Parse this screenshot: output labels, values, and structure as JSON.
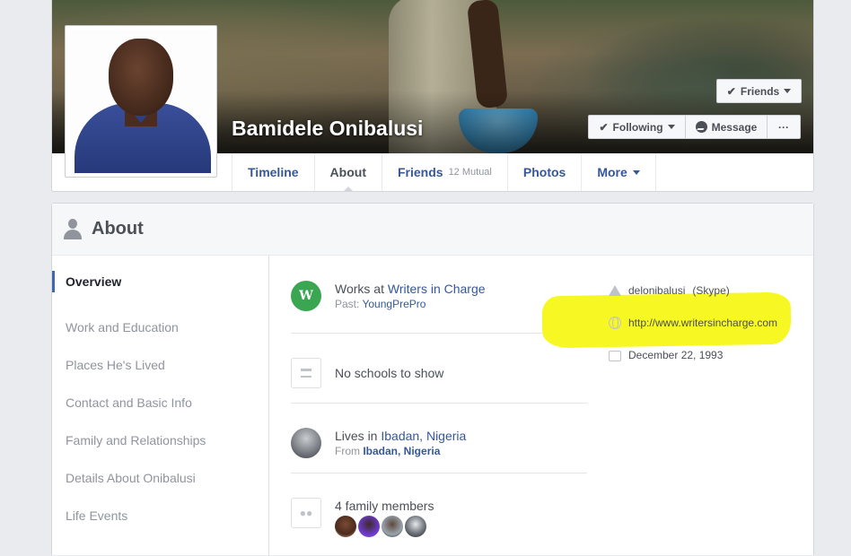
{
  "profile": {
    "name": "Bamidele Onibalusi"
  },
  "actions": {
    "friends": "Friends",
    "following": "Following",
    "message": "Message",
    "more": "···"
  },
  "tabs": [
    {
      "label": "Timeline"
    },
    {
      "label": "About"
    },
    {
      "label": "Friends",
      "sub": "12 Mutual"
    },
    {
      "label": "Photos"
    },
    {
      "label": "More"
    }
  ],
  "about": {
    "title": "About",
    "nav": [
      "Overview",
      "Work and Education",
      "Places He's Lived",
      "Contact and Basic Info",
      "Family and Relationships",
      "Details About Onibalusi",
      "Life Events"
    ],
    "overview": {
      "work": {
        "prefix": "Works at ",
        "employer": "Writers in Charge",
        "past_prefix": "Past: ",
        "past": "YoungPrePro"
      },
      "education": {
        "text": "No schools to show"
      },
      "place": {
        "prefix": "Lives in ",
        "city": "Ibadan, Nigeria",
        "from_prefix": "From ",
        "from": "Ibadan, Nigeria"
      },
      "family": {
        "text": "4 family members"
      }
    },
    "contact": {
      "skype": "delonibalusi",
      "skype_label": "(Skype)",
      "website": "http://www.writersincharge.com",
      "birthday": "December 22, 1993"
    }
  },
  "colors": {
    "link": "#365899",
    "highlight": "#f7f723",
    "accent": "#4267b2"
  }
}
